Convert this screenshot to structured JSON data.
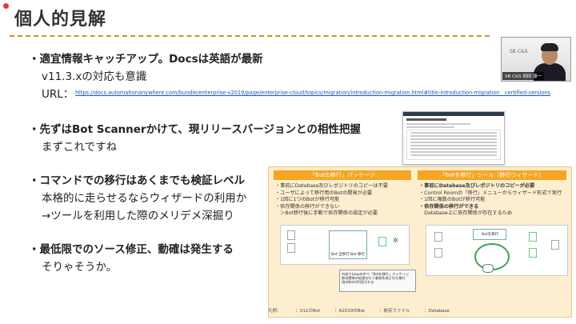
{
  "slide": {
    "title": "個人的見解"
  },
  "points": [
    {
      "bullet": "・適宜情報キャッチアップ。Docsは英語が最新",
      "sub": [
        "v11.3.xの対応も意識"
      ]
    },
    {
      "bullet": "・先ずはBot Scannerかけて、現リリースバージョンとの相性把握",
      "sub": [
        "まずこれですね"
      ]
    },
    {
      "bullet": "・コマンドでの移行はあくまでも検証レベル",
      "sub": [
        "本格的に走らせるならウィザードの利用か",
        "→ツールを利用した際のメリデメ深掘り"
      ]
    },
    {
      "bullet": "・最低限でのソース修正、動確は発生する",
      "sub": [
        "そりゃそうか。"
      ]
    }
  ],
  "url": {
    "label": "URL：",
    "link": "https://docs.automationanywhere.com/bundle/enterprise-v2019/page/enterprise-cloud/topics/migration/introduction-migration.html#title-introduction-migration__certified-versions"
  },
  "webcam": {
    "logo": "SB C&S",
    "name": "SB C&S 岡田 康一"
  },
  "panel": {
    "left": {
      "header": "「Botの移行」パッケージ",
      "items": [
        "・事前にDatabase及びレポジトリのコピーは不要",
        "・ユーザによって移行用のBotの開発が必要",
        "・1回に1つのBotが移行可能",
        "・依存関係の移行ができない",
        "　＞Bot移行後に手動で依存関係の設定が必要"
      ]
    },
    "right": {
      "header": "「Botを移行」ツール（移行ウィザード）",
      "items": [
        "・事前にDatabase及びレポジトリのコピーが必要",
        "・Control Roomの「移行」メニューからウィザード形式で実行",
        "・1回に複数のBotが移行可能",
        "・依存関係の移行ができる",
        "　Database上に依存関係が存在するため"
      ]
    },
    "box_label": "Botを移行",
    "left_box": "Bot 全移行  Bot 移行",
    "note": "内部でLoopの中で「Botを移行」パッケージ\n依存関係の処理を行う事前作成された移行\n用のBotが利用される"
  },
  "legend": {
    "title": "凡例：",
    "items": [
      "：V11のBot",
      "：A2019のBot",
      "：依存ファイル",
      "：Database"
    ]
  }
}
